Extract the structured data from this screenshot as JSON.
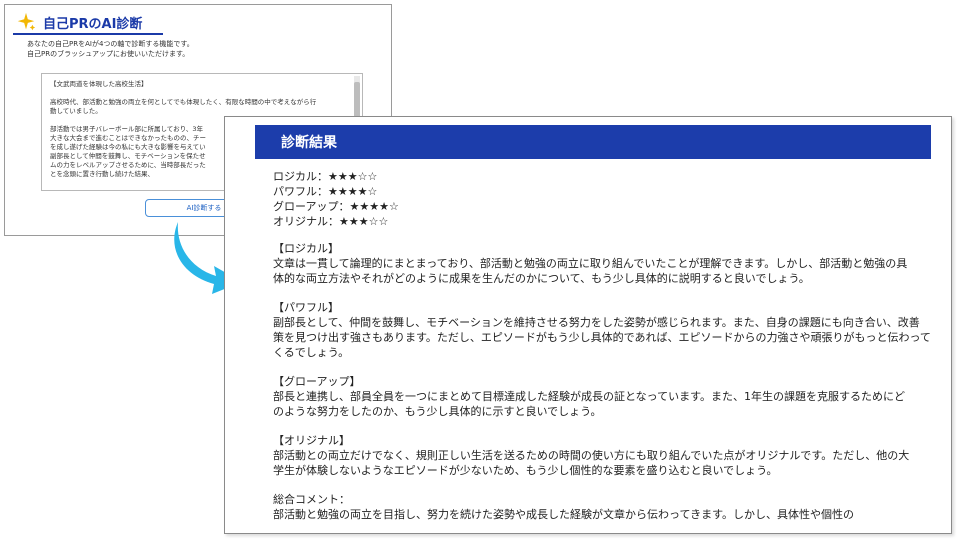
{
  "back_panel": {
    "title": "自己PRのAI診断",
    "description": [
      "あなたの自己PRをAIが4つの軸で診断する機能です。",
      "自己PRのブラッシュアップにお使いいただけます。"
    ],
    "essay_paragraphs": [
      [
        "【文武両道を体現した高校生活】"
      ],
      [
        "高校時代、部活動と勉強の両立を何としてでも体現したく、有限な時間の中で考えながら行",
        "動していました。"
      ],
      [
        "部活動では男子バレーボール部に所属しており、3年",
        "大きな大会まで進むことはできなかったものの、チー",
        "を成し遂げた経験は今の私にも大きな影響を与えてい",
        "副部長として仲間を鼓舞し、モチベーションを保たせ",
        "ムの力をレベルアップさせるために、当時部長だった",
        "とを念頭に置き行動し続けた結果、"
      ]
    ],
    "button_label": "AI診断する"
  },
  "front_panel": {
    "title": "診断結果",
    "ratings": [
      "ロジカル：★★★☆☆",
      "パワフル：★★★★☆",
      "グローアップ：★★★★☆",
      "オリジナル：★★★☆☆"
    ],
    "sections": [
      {
        "heading": "【ロジカル】",
        "lines": [
          "文章は一貫して論理的にまとまっており、部活動と勉強の両立に取り組んでいたことが理解できます。しかし、部活動と勉強の具",
          "体的な両立方法やそれがどのように成果を生んだのかについて、もう少し具体的に説明すると良いでしょう。"
        ]
      },
      {
        "heading": "【パワフル】",
        "lines": [
          "副部長として、仲間を鼓舞し、モチベーションを維持させる努力をした姿勢が感じられます。また、自身の課題にも向き合い、改善",
          "策を見つけ出す強さもあります。ただし、エピソードがもう少し具体的であれば、エピソードからの力強さや頑張りがもっと伝わって",
          "くるでしょう。"
        ]
      },
      {
        "heading": "【グローアップ】",
        "lines": [
          "部長と連携し、部員全員を一つにまとめて目標達成した経験が成長の証となっています。また、1年生の課題を克服するためにど",
          "のような努力をしたのか、もう少し具体的に示すと良いでしょう。"
        ]
      },
      {
        "heading": "【オリジナル】",
        "lines": [
          "部活動との両立だけでなく、規則正しい生活を送るための時間の使い方にも取り組んでいた点がオリジナルです。ただし、他の大",
          "学生が体験しないようなエピソードが少ないため、もう少し個性的な要素を盛り込むと良いでしょう。"
        ]
      },
      {
        "heading": "総合コメント：",
        "lines": [
          "部活動と勉強の両立を目指し、努力を続けた姿勢や成長した経験が文章から伝わってきます。しかし、具体性や個性の"
        ]
      }
    ]
  },
  "colors": {
    "accent_blue": "#1c3dab",
    "arrow_cyan": "#29b6e8",
    "sparkle_yellow": "#f2b705"
  },
  "icons": {
    "sparkle": "sparkle-icon",
    "arrow": "curved-arrow-icon"
  }
}
